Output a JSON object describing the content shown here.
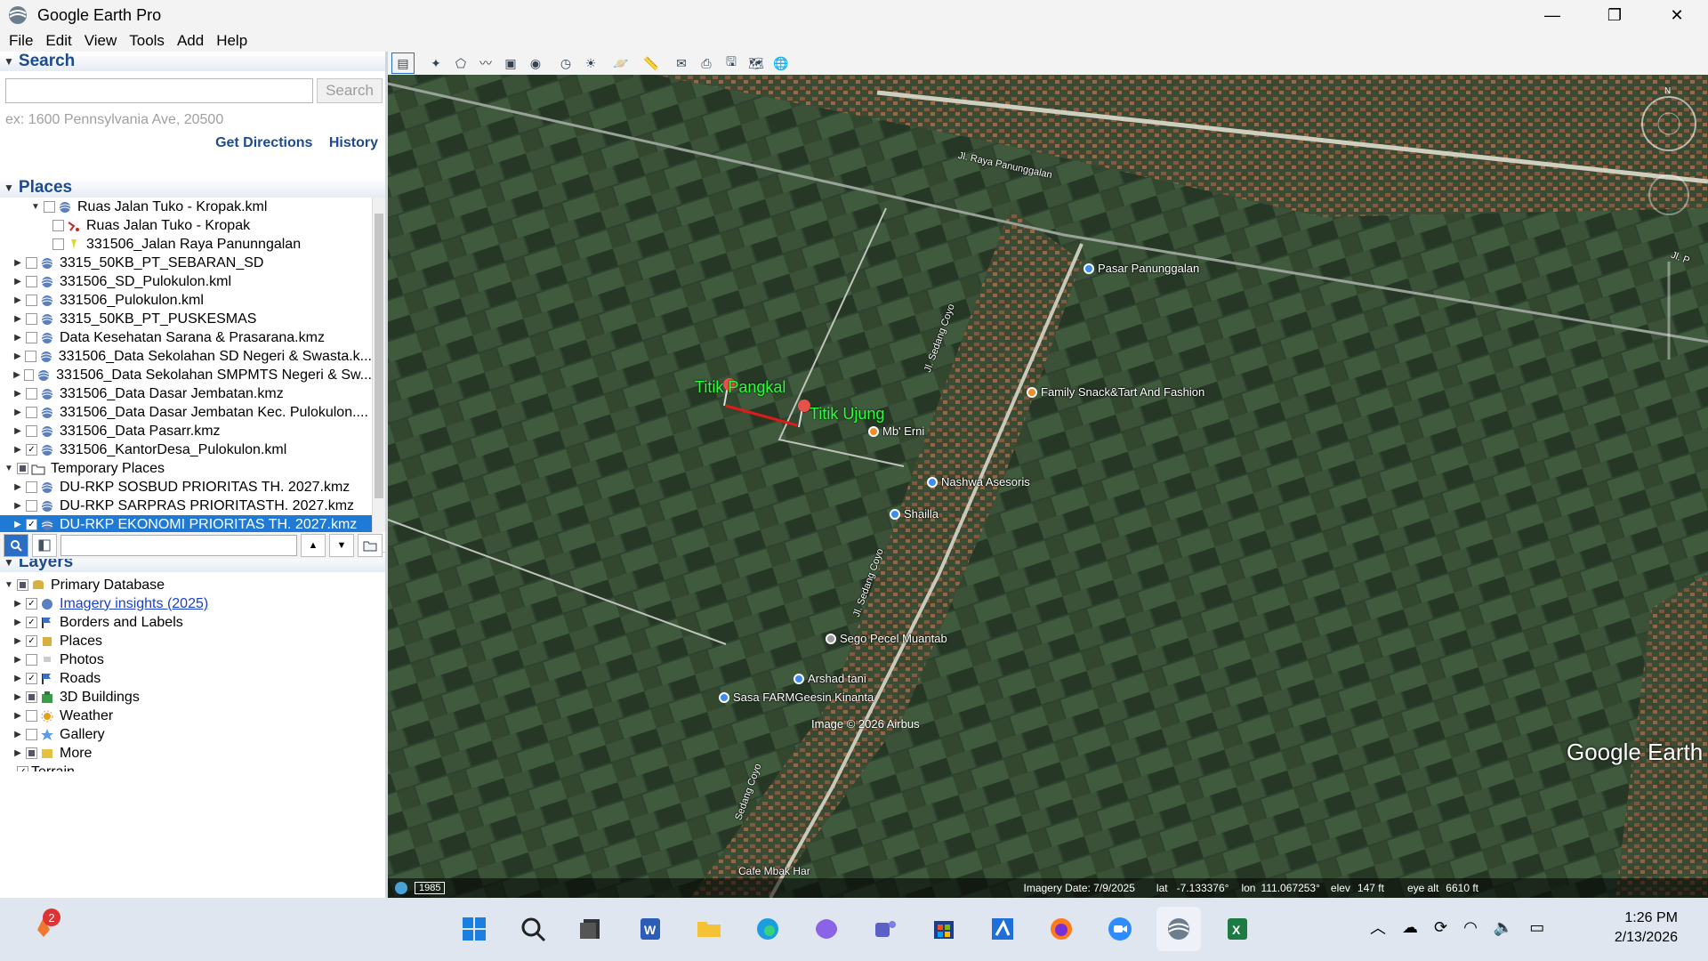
{
  "window": {
    "title": "Google Earth Pro",
    "minimize": "—",
    "maximize": "❐",
    "close": "✕"
  },
  "menu": [
    "File",
    "Edit",
    "View",
    "Tools",
    "Add",
    "Help"
  ],
  "search": {
    "header": "Search",
    "input_value": "",
    "button": "Search",
    "hint": "ex: 1600 Pennsylvania Ave, 20500",
    "links": [
      "Get Directions",
      "History"
    ]
  },
  "places": {
    "header": "Places",
    "items": [
      {
        "indent": 3,
        "label": "Ruas Jalan Tuko - Kropak.kml",
        "checked": false,
        "expanded": true,
        "icon": "kml-icon"
      },
      {
        "indent": 4,
        "label": "Ruas Jalan Tuko - Kropak",
        "checked": false,
        "icon": "path-icon"
      },
      {
        "indent": 4,
        "label": "331506_Jalan Raya Panunngalan",
        "checked": false,
        "icon": "pin-icon"
      },
      {
        "indent": 1,
        "label": "3315_50KB_PT_SEBARAN_SD",
        "checked": false,
        "icon": "kml-icon"
      },
      {
        "indent": 1,
        "label": "331506_SD_Pulokulon.kml",
        "checked": false,
        "icon": "kml-icon"
      },
      {
        "indent": 1,
        "label": "331506_Pulokulon.kml",
        "checked": false,
        "icon": "kml-icon"
      },
      {
        "indent": 1,
        "label": "3315_50KB_PT_PUSKESMAS",
        "checked": false,
        "icon": "kml-icon"
      },
      {
        "indent": 1,
        "label": "Data Kesehatan Sarana & Prasarana.kmz",
        "checked": false,
        "icon": "kml-icon"
      },
      {
        "indent": 1,
        "label": "331506_Data Sekolahan SD Negeri & Swasta.k...",
        "checked": false,
        "icon": "kml-icon"
      },
      {
        "indent": 1,
        "label": "331506_Data Sekolahan SMPMTS Negeri & Sw...",
        "checked": false,
        "icon": "kml-icon"
      },
      {
        "indent": 1,
        "label": "331506_Data Dasar Jembatan.kmz",
        "checked": false,
        "icon": "kml-icon"
      },
      {
        "indent": 1,
        "label": "331506_Data Dasar Jembatan Kec. Pulokulon....",
        "checked": false,
        "icon": "kml-icon"
      },
      {
        "indent": 1,
        "label": "331506_Data Pasarr.kmz",
        "checked": false,
        "icon": "kml-icon"
      },
      {
        "indent": 1,
        "label": "331506_KantorDesa_Pulokulon.kml",
        "checked": true,
        "icon": "kml-icon"
      },
      {
        "indent": 0,
        "label": "Temporary Places",
        "checked": "mixed",
        "expanded": true,
        "icon": "folder-icon"
      },
      {
        "indent": 1,
        "label": "DU-RKP SOSBUD PRIORITAS TH. 2027.kmz",
        "checked": false,
        "icon": "kml-icon"
      },
      {
        "indent": 1,
        "label": "DU-RKP SARPRAS PRIORITASTH. 2027.kmz",
        "checked": false,
        "icon": "kml-icon"
      },
      {
        "indent": 1,
        "label": "DU-RKP EKONOMI PRIORITAS TH. 2027.kmz",
        "checked": true,
        "icon": "kml-icon",
        "selected": true
      }
    ]
  },
  "layers": {
    "header": "Layers",
    "items": [
      {
        "indent": 0,
        "label": "Primary Database",
        "checked": "mixed",
        "icon": "database-icon",
        "expanded": true
      },
      {
        "indent": 1,
        "label": "Imagery insights (2025)",
        "checked": true,
        "icon": "imagery-icon",
        "link": true
      },
      {
        "indent": 1,
        "label": "Borders and Labels",
        "checked": true,
        "icon": "flag-icon"
      },
      {
        "indent": 1,
        "label": "Places",
        "checked": true,
        "icon": "places-icon"
      },
      {
        "indent": 1,
        "label": "Photos",
        "checked": false,
        "icon": "photo-icon"
      },
      {
        "indent": 1,
        "label": "Roads",
        "checked": true,
        "icon": "road-icon"
      },
      {
        "indent": 1,
        "label": "3D Buildings",
        "checked": "mixed",
        "icon": "building-icon"
      },
      {
        "indent": 1,
        "label": "Weather",
        "checked": false,
        "icon": "weather-icon"
      },
      {
        "indent": 1,
        "label": "Gallery",
        "checked": false,
        "icon": "gallery-icon"
      },
      {
        "indent": 1,
        "label": "More",
        "checked": "mixed",
        "icon": "more-icon"
      },
      {
        "indent": 0,
        "label": "Terrain",
        "checked": true,
        "icon": "",
        "noexp": true
      }
    ]
  },
  "map": {
    "labels": {
      "pangkal": "Titik Pangkal",
      "ujung": "Titik Ujung"
    },
    "pois": [
      "Pasar Panunggalan",
      "Family Snack&Tart And Fashion",
      "Mb' Erni",
      "Nashwa Asesoris",
      "Shailla",
      "Sego Pecel Muantab",
      "Arshad tani",
      "Sasa FARMGeesin Kinanta"
    ],
    "roads": [
      "Jl. Raya Panunggalan",
      "Jl. Sedang Coyo",
      "Jl. Sedang Coyo",
      "Sedang Coyo",
      "Jl. P"
    ],
    "bottom_cut": "Cafe Mbak Har",
    "image_credit": "Image © 2026 Airbus",
    "watermark": "Google Earth",
    "status": {
      "year": "1985",
      "imagery_date": "Imagery Date: 7/9/2025",
      "lat_label": "lat",
      "lat": "-7.133376°",
      "lon_label": "lon",
      "lon": "111.067253°",
      "elev_label": "elev",
      "elev": "147 ft",
      "eye_label": "eye alt",
      "eye": "6610 ft"
    }
  },
  "taskbar": {
    "notification_count": "2",
    "time": "1:26 PM",
    "date": "2/13/2026"
  },
  "colors": {
    "accent": "#1f7ad6",
    "header_text": "#1e4b8f",
    "label_green": "#2bff3d",
    "path_red": "#e01a1a"
  }
}
